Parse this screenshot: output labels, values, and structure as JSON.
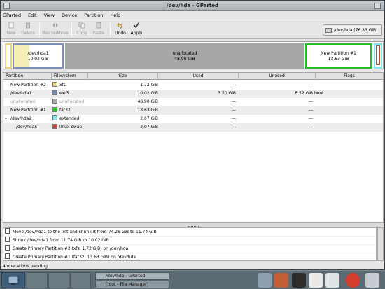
{
  "window": {
    "title": "/dev/hda - GParted"
  },
  "menubar": [
    "GParted",
    "Edit",
    "View",
    "Device",
    "Partition",
    "Help"
  ],
  "toolbar": {
    "new": "New",
    "delete": "Delete",
    "resize_move": "Resize/Move",
    "copy": "Copy",
    "paste": "Paste",
    "undo": "Undo",
    "apply": "Apply"
  },
  "device": {
    "label": "/dev/hda  (76.33 GiB)"
  },
  "partition_map": {
    "hda1_name": "/dev/hda1",
    "hda1_size": "10.02 GiB",
    "unalloc_name": "unallocated",
    "unalloc_size": "48.90 GiB",
    "new1_name": "New Partition #1",
    "new1_size": "13.63 GiB"
  },
  "table": {
    "headers": [
      "Partition",
      "Filesystem",
      "Size",
      "Used",
      "Unused",
      "Flags"
    ],
    "rows": [
      {
        "partition": "New Partition #2",
        "fs": "xfs",
        "color": "#e8d47a",
        "size": "1.72 GiB",
        "used": "---",
        "unused": "---",
        "flags": ""
      },
      {
        "partition": "/dev/hda1",
        "fs": "ext3",
        "color": "#7a90b8",
        "size": "10.02 GiB",
        "used": "3.50 GiB",
        "unused": "6.52 GiB",
        "flags": "boot"
      },
      {
        "partition": "unallocated",
        "fs": "unallocated",
        "color": "#a6a6a6",
        "size": "48.90 GiB",
        "used": "---",
        "unused": "---",
        "flags": ""
      },
      {
        "partition": "New Partition #1",
        "fs": "fat32",
        "color": "#2ec52e",
        "size": "13.63 GiB",
        "used": "---",
        "unused": "---",
        "flags": ""
      },
      {
        "partition": "/dev/hda2",
        "fs": "extended",
        "color": "#7de8ef",
        "size": "2.07 GiB",
        "used": "---",
        "unused": "---",
        "flags": ""
      },
      {
        "partition": "/dev/hda5",
        "fs": "linux-swap",
        "color": "#c04a3c",
        "size": "2.07 GiB",
        "used": "---",
        "unused": "---",
        "flags": ""
      }
    ]
  },
  "pending": {
    "ops": [
      "Move /dev/hda1 to the left and shrink it from 74.26 GiB to 11.74 GiB",
      "Shrink /dev/hda1 from 11.74 GiB to 10.02 GiB",
      "Create Primary Partition #2 (xfs, 1.72 GiB) on /dev/hda",
      "Create Primary Partition #1 (fat32, 13.63 GiB) on /dev/hda"
    ],
    "status": "4 operations pending"
  },
  "taskbar": {
    "tasks": [
      "/dev/hda - GParted",
      "[root - File Manager]"
    ]
  },
  "colors": {
    "accent_selected": "#22c022",
    "swap_red": "#c04a3c",
    "extended_cyan": "#7de8ef"
  }
}
